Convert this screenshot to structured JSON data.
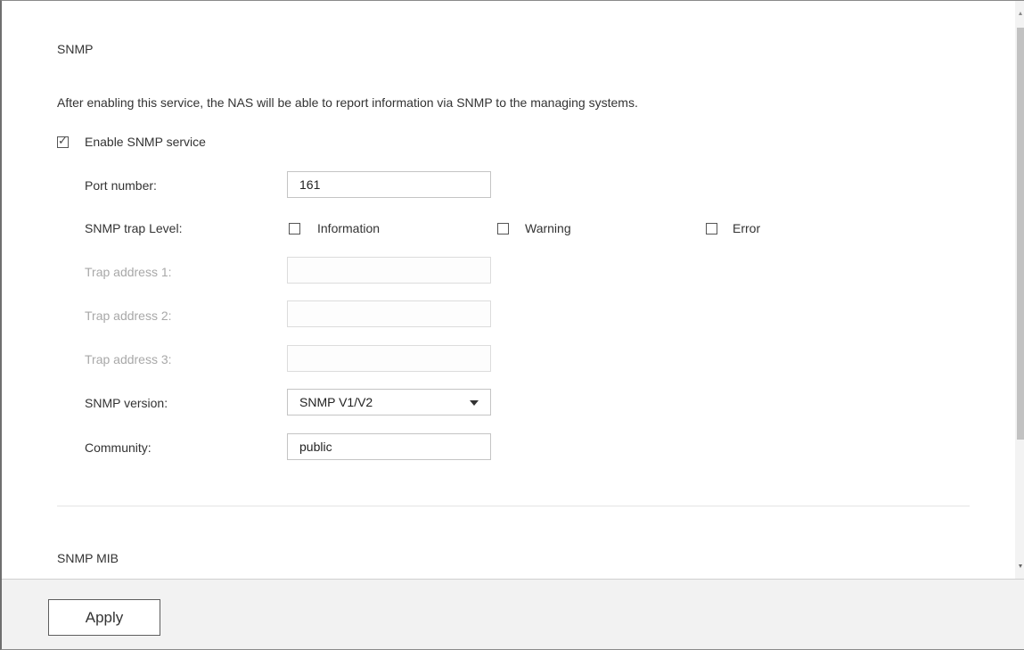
{
  "snmp_section": {
    "title": "SNMP",
    "description": "After enabling this service, the NAS will be able to report information via SNMP to the managing systems.",
    "enable_label": "Enable SNMP service",
    "enable_checked": true,
    "check_glyph": "✓",
    "port_label": "Port number:",
    "port_value": "161",
    "trap_level_label": "SNMP trap Level:",
    "trap_levels": [
      {
        "label": "Information",
        "checked": false
      },
      {
        "label": "Warning",
        "checked": false
      },
      {
        "label": "Error",
        "checked": false
      }
    ],
    "trap_address_1_label": "Trap address 1:",
    "trap_address_1_value": "",
    "trap_address_2_label": "Trap address 2:",
    "trap_address_2_value": "",
    "trap_address_3_label": "Trap address 3:",
    "trap_address_3_value": "",
    "version_label": "SNMP version:",
    "version_value": "SNMP V1/V2",
    "community_label": "Community:",
    "community_value": "public"
  },
  "mib_section": {
    "title": "SNMP MIB"
  },
  "footer": {
    "apply_label": "Apply"
  },
  "icons": {
    "select_caret": "chevron-down-icon",
    "scroll_up": "scroll-up-arrow-icon",
    "scroll_down": "scroll-down-arrow-icon"
  },
  "colors": {
    "footer_bg": "#f2f2f2",
    "disabled_text": "#a8a8a8",
    "scroll_thumb": "#c2c2c2"
  }
}
